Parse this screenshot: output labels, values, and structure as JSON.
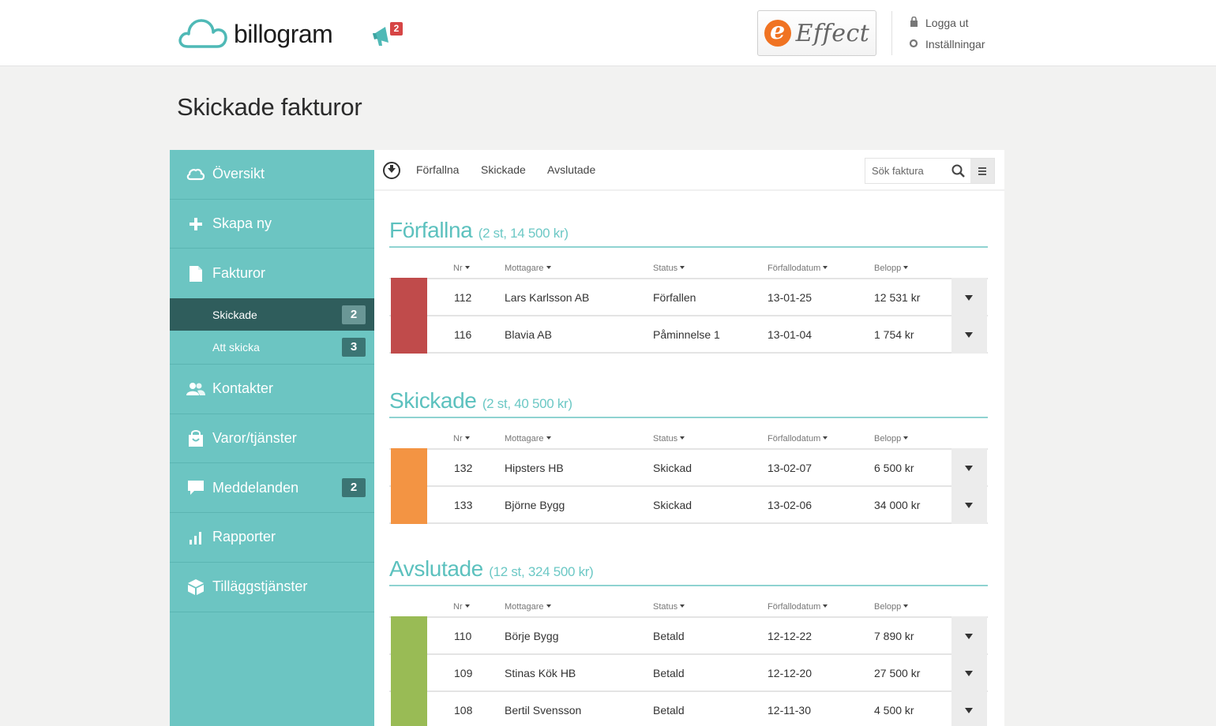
{
  "header": {
    "logo_text": "billogram",
    "notification_count": "2",
    "partner_e": "e",
    "partner_name": "Effect",
    "logout_label": "Logga ut",
    "settings_label": "Inställningar"
  },
  "page": {
    "title": "Skickade fakturor"
  },
  "sidebar": {
    "items": [
      {
        "label": "Översikt"
      },
      {
        "label": "Skapa ny"
      },
      {
        "label": "Fakturor"
      },
      {
        "label": "Kontakter"
      },
      {
        "label": "Varor/tjänster"
      },
      {
        "label": "Meddelanden",
        "count": "2"
      },
      {
        "label": "Rapporter"
      },
      {
        "label": "Tilläggstjänster"
      }
    ],
    "sub_items": [
      {
        "label": "Skickade",
        "count": "2"
      },
      {
        "label": "Att skicka",
        "count": "3"
      }
    ]
  },
  "toolbar": {
    "tabs": [
      "Förfallna",
      "Skickade",
      "Avslutade"
    ],
    "search_placeholder": "Sök faktura"
  },
  "columns": [
    "Nr",
    "Mottagare",
    "Status",
    "Förfallodatum",
    "Belopp"
  ],
  "colors": {
    "overdue": "#c04b4b",
    "sent": "#f39443",
    "closed": "#99bb55",
    "accent": "#5cc1be"
  },
  "sections": [
    {
      "title": "Förfallna",
      "summary": "(2 st, 14 500 kr)",
      "rows": [
        {
          "nr": "112",
          "recipient": "Lars Karlsson AB",
          "status": "Förfallen",
          "due": "13-01-25",
          "amount": "12 531 kr"
        },
        {
          "nr": "116",
          "recipient": "Blavia AB",
          "status": "Påminnelse 1",
          "due": "13-01-04",
          "amount": "1 754 kr"
        }
      ]
    },
    {
      "title": "Skickade",
      "summary": "(2 st, 40 500 kr)",
      "rows": [
        {
          "nr": "132",
          "recipient": "Hipsters HB",
          "status": "Skickad",
          "due": "13-02-07",
          "amount": "6 500 kr"
        },
        {
          "nr": "133",
          "recipient": "Björne Bygg",
          "status": "Skickad",
          "due": "13-02-06",
          "amount": "34 000 kr"
        }
      ]
    },
    {
      "title": "Avslutade",
      "summary": "(12 st, 324 500 kr)",
      "rows": [
        {
          "nr": "110",
          "recipient": "Börje Bygg",
          "status": "Betald",
          "due": "12-12-22",
          "amount": "7 890 kr"
        },
        {
          "nr": "109",
          "recipient": "Stinas Kök HB",
          "status": "Betald",
          "due": "12-12-20",
          "amount": "27 500 kr"
        },
        {
          "nr": "108",
          "recipient": "Bertil Svensson",
          "status": "Betald",
          "due": "12-11-30",
          "amount": "4 500 kr"
        }
      ]
    }
  ]
}
